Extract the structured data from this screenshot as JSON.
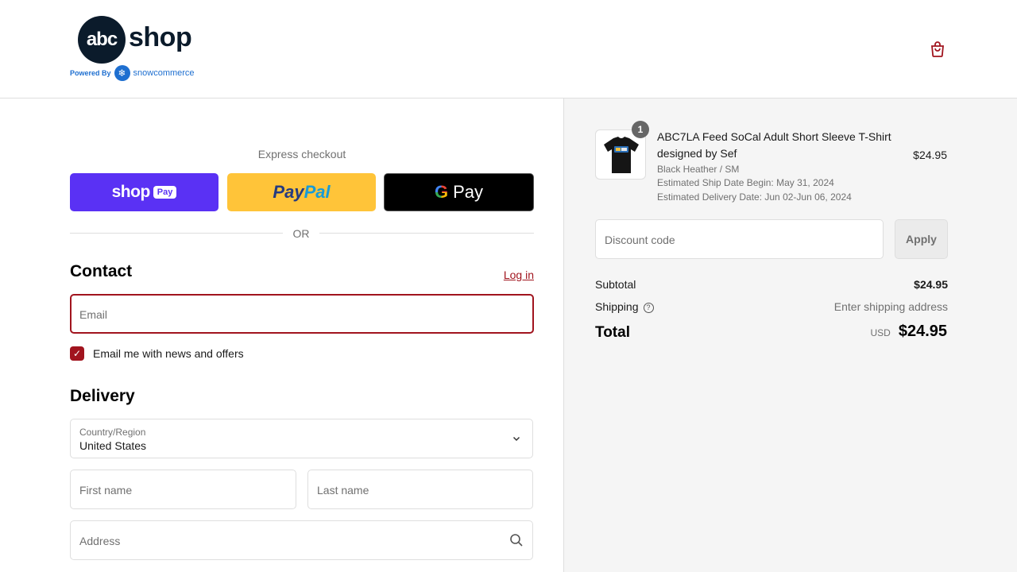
{
  "header": {
    "logo": {
      "mark": "abc",
      "word": "shop",
      "powered_by": "Powered By",
      "partner": "snowcommerce"
    },
    "cart_icon": "shopping-bag-icon"
  },
  "express": {
    "title": "Express checkout",
    "buttons": {
      "shop_pay": {
        "word": "shop",
        "pill": "Pay"
      },
      "paypal": {
        "pay": "Pay",
        "pal": "Pal"
      },
      "google_pay": {
        "g": "G",
        "word": "Pay"
      }
    },
    "or_label": "OR"
  },
  "contact": {
    "title": "Contact",
    "login_label": "Log in",
    "email_placeholder": "Email",
    "newsletter_label": "Email me with news and offers",
    "newsletter_checked": true
  },
  "delivery": {
    "title": "Delivery",
    "country_label": "Country/Region",
    "country_value": "United States",
    "first_name_placeholder": "First name",
    "last_name_placeholder": "Last name",
    "address_placeholder": "Address"
  },
  "order": {
    "item": {
      "quantity": "1",
      "title": "ABC7LA Feed SoCal Adult Short Sleeve T-Shirt designed by Sef",
      "variant": "Black Heather / SM",
      "ship_date": "Estimated Ship Date Begin: May 31, 2024",
      "delivery_date": "Estimated Delivery Date: Jun 02-Jun 06, 2024",
      "price": "$24.95"
    },
    "discount_placeholder": "Discount code",
    "apply_label": "Apply",
    "subtotal_label": "Subtotal",
    "subtotal_value": "$24.95",
    "shipping_label": "Shipping",
    "shipping_value": "Enter shipping address",
    "total_label": "Total",
    "total_currency": "USD",
    "total_value": "$24.95"
  },
  "colors": {
    "accent": "#a1141e",
    "shop_pay": "#5a31f4",
    "paypal": "#ffc439",
    "summary_bg": "#f5f5f5"
  }
}
